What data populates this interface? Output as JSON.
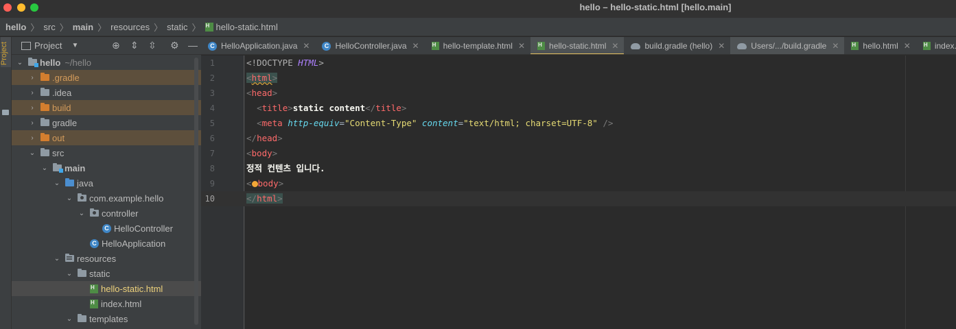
{
  "window": {
    "title": "hello – hello-static.html [hello.main]"
  },
  "breadcrumb": {
    "items": [
      "hello",
      "src",
      "main",
      "resources",
      "static",
      "hello-static.html"
    ]
  },
  "toolstrip": {
    "project_tab_label": "Project"
  },
  "project_panel": {
    "header_title": "Project",
    "tree": [
      {
        "label": "hello",
        "sub": "~/hello",
        "icon": "module-folder-icon",
        "expanded": true
      },
      {
        "label": ".gradle",
        "icon": "folder-icon",
        "expanded": false,
        "excluded": true
      },
      {
        "label": ".idea",
        "icon": "folder-icon",
        "expanded": false
      },
      {
        "label": "build",
        "icon": "folder-icon",
        "expanded": false,
        "excluded": true
      },
      {
        "label": "gradle",
        "icon": "folder-icon",
        "expanded": false
      },
      {
        "label": "out",
        "icon": "folder-icon",
        "expanded": false,
        "excluded": true
      },
      {
        "label": "src",
        "icon": "folder-icon",
        "expanded": true
      },
      {
        "label": "main",
        "icon": "source-root-folder-icon",
        "expanded": true
      },
      {
        "label": "java",
        "icon": "java-source-folder-icon",
        "expanded": true
      },
      {
        "label": "com.example.hello",
        "icon": "package-icon",
        "expanded": true
      },
      {
        "label": "controller",
        "icon": "package-icon",
        "expanded": true
      },
      {
        "label": "HelloController",
        "icon": "class-icon"
      },
      {
        "label": "HelloApplication",
        "icon": "spring-app-class-icon"
      },
      {
        "label": "resources",
        "icon": "resources-folder-icon",
        "expanded": true
      },
      {
        "label": "static",
        "icon": "folder-icon",
        "expanded": true
      },
      {
        "label": "hello-static.html",
        "icon": "html-file-icon",
        "selected": true
      },
      {
        "label": "index.html",
        "icon": "html-file-icon"
      },
      {
        "label": "templates",
        "icon": "folder-icon",
        "expanded": true
      }
    ]
  },
  "tabs": [
    {
      "label": "HelloApplication.java",
      "icon": "spring-app-class-icon"
    },
    {
      "label": "HelloController.java",
      "icon": "class-icon"
    },
    {
      "label": "hello-template.html",
      "icon": "html-file-icon"
    },
    {
      "label": "hello-static.html",
      "icon": "html-file-icon",
      "active": true
    },
    {
      "label": "build.gradle (hello)",
      "icon": "gradle-icon"
    },
    {
      "label": "Users/.../build.gradle",
      "icon": "gradle-icon"
    },
    {
      "label": "hello.html",
      "icon": "html-file-icon"
    },
    {
      "label": "index.html",
      "icon": "html-file-icon"
    }
  ],
  "editor": {
    "current_line": 10,
    "line_numbers": [
      "1",
      "2",
      "3",
      "4",
      "5",
      "6",
      "7",
      "8",
      "9",
      "10"
    ],
    "code": {
      "l1_open": "<!DOCTYPE ",
      "l1_name": "HTML",
      "l1_close": ">",
      "l2_lt": "<",
      "l2_tag": "html",
      "l2_gt": ">",
      "l3_lt": "<",
      "l3_tag": "head",
      "l3_gt": ">",
      "l4_indent": "  ",
      "l4_lt": "<",
      "l4_tag": "title",
      "l4_gt": ">",
      "l4_text": "static content",
      "l4_clt": "</",
      "l4_ctag": "title",
      "l4_cgt": ">",
      "l5_indent": "  ",
      "l5_lt": "<",
      "l5_tag": "meta",
      "l5_attr1": "http-equiv",
      "l5_eq1": "=",
      "l5_val1": "\"Content-Type\"",
      "l5_attr2": "content",
      "l5_eq2": "=",
      "l5_val2": "\"text/html; charset=UTF-8\"",
      "l5_end": " />",
      "l6_lt": "</",
      "l6_tag": "head",
      "l6_gt": ">",
      "l7_lt": "<",
      "l7_tag": "body",
      "l7_gt": ">",
      "l8_text": "정적 컨텐츠 입니다.",
      "l9_lt": "<",
      "l9_tag": "body",
      "l9_gt": ">",
      "l10_lt": "</",
      "l10_tag": "html",
      "l10_gt": ">"
    }
  }
}
